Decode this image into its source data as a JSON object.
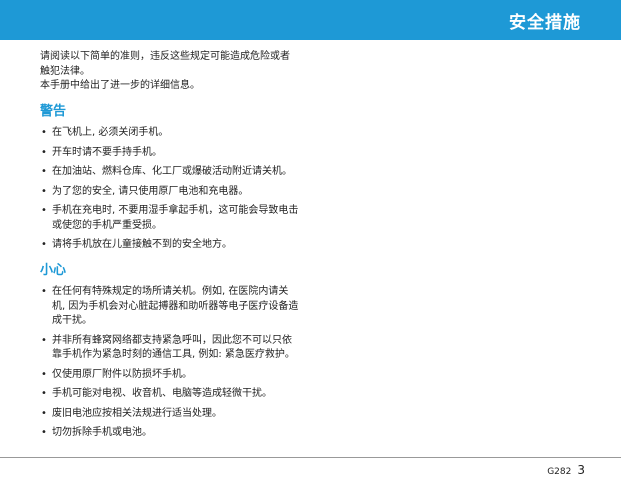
{
  "header": {
    "title": "安全措施",
    "colors": {
      "bar": "#1e99d6",
      "title_text": "#ffffff"
    }
  },
  "intro": {
    "line1": "请阅读以下简单的准则，违反这些规定可能造成危险或者",
    "line2": "触犯法律。",
    "line3": "本手册中给出了进一步的详细信息。"
  },
  "warning": {
    "title": "警告",
    "items": [
      "在飞机上, 必须关闭手机。",
      "开车时请不要手持手机。",
      "在加油站、燃料仓库、化工厂或爆破活动附近请关机。",
      "为了您的安全, 请只使用原厂电池和充电器。",
      "手机在充电时, 不要用湿手拿起手机，这可能会导致电击或使您的手机严重受损。",
      "请将手机放在儿童接触不到的安全地方。"
    ]
  },
  "caution": {
    "title": "小心",
    "items": [
      "在任何有特殊规定的场所请关机。例如, 在医院内请关机, 因为手机会对心脏起搏器和助听器等电子医疗设备造成干扰。",
      "并非所有蜂窝网络都支持紧急呼叫，因此您不可以只依靠手机作为紧急时刻的通信工具, 例如: 紧急医疗救护。",
      "仅使用原厂附件以防损坏手机。",
      "手机可能对电视、收音机、电脑等造成轻微干扰。",
      "废旧电池应按相关法规进行适当处理。",
      "切勿拆除手机或电池。"
    ]
  },
  "footer": {
    "model": "G282",
    "page_number": "3"
  }
}
